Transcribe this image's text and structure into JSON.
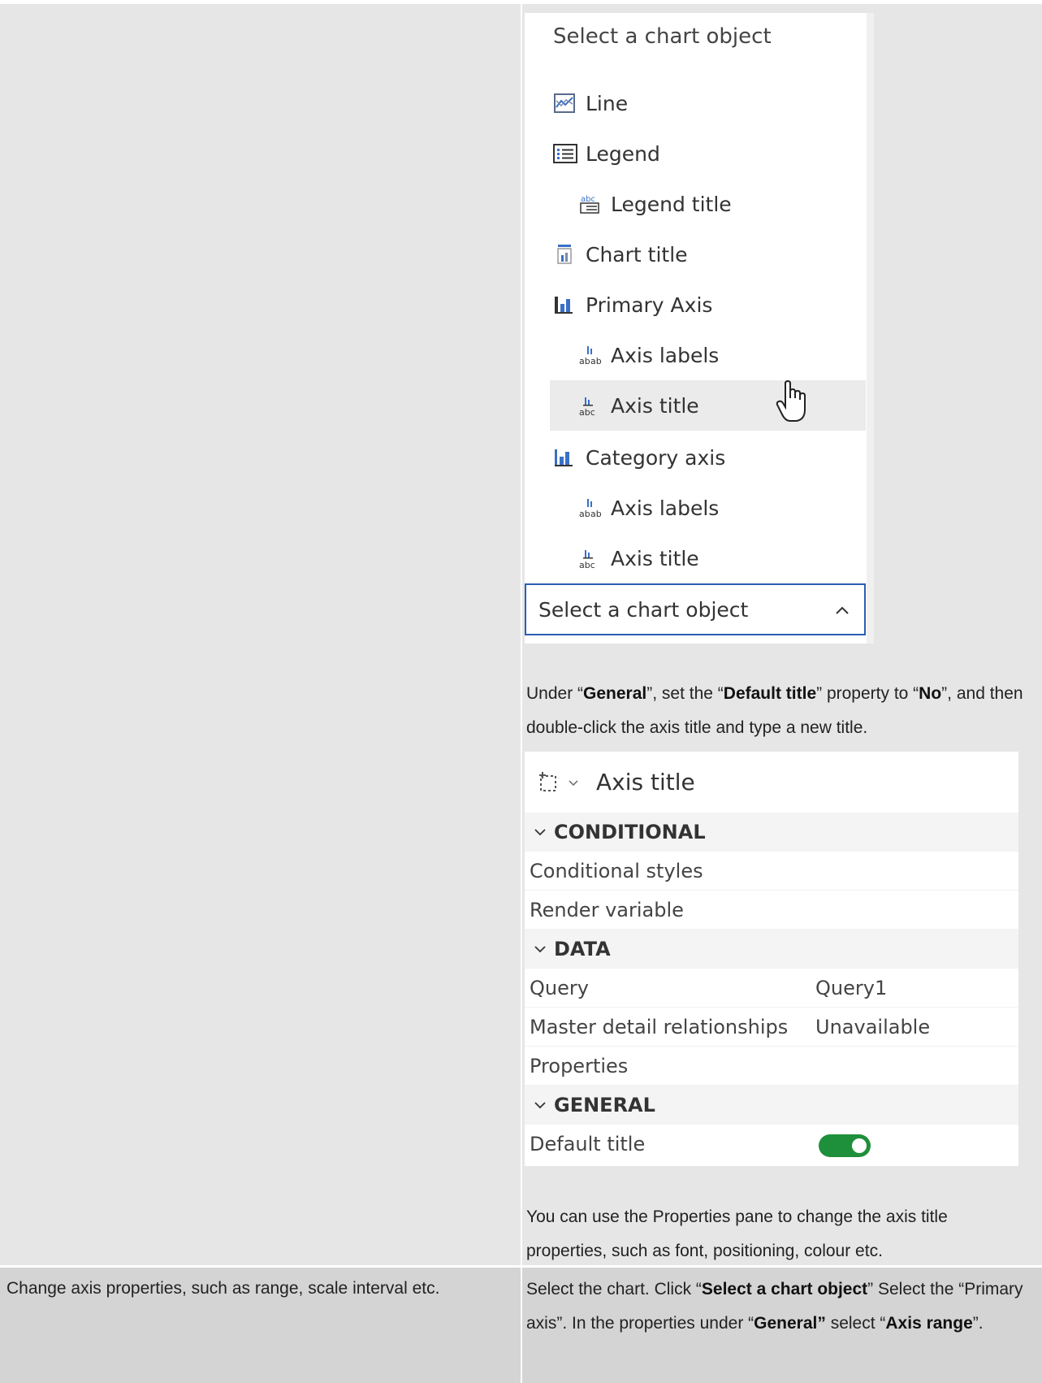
{
  "menu": {
    "header": "Select a chart object",
    "items": [
      {
        "label": "Line",
        "icon": "line-chart-icon",
        "indent": false
      },
      {
        "label": "Legend",
        "icon": "legend-icon",
        "indent": false
      },
      {
        "label": "Legend title",
        "icon": "legend-title-icon",
        "indent": true
      },
      {
        "label": "Chart title",
        "icon": "chart-title-icon",
        "indent": false
      },
      {
        "label": "Primary Axis",
        "icon": "primary-axis-icon",
        "indent": false
      },
      {
        "label": "Axis labels",
        "icon": "axis-labels-icon",
        "indent": true
      },
      {
        "label": "Axis title",
        "icon": "axis-title-icon",
        "indent": true,
        "highlighted": true
      },
      {
        "label": "Category axis",
        "icon": "category-axis-icon",
        "indent": false
      },
      {
        "label": "Axis labels",
        "icon": "axis-labels-icon",
        "indent": true
      },
      {
        "label": "Axis title",
        "icon": "axis-title-icon",
        "indent": true
      }
    ],
    "select_label": "Select a chart object"
  },
  "para1": {
    "t1": "Under “",
    "b1": "General",
    "t2": "”, set the “",
    "b2": "Default title",
    "t3": "” property to “",
    "b3": "No",
    "t4": "”, and then double-click the axis title and type a new title."
  },
  "properties": {
    "title": "Axis title",
    "sections": {
      "conditional": "CONDITIONAL",
      "data": "DATA",
      "general": "GENERAL"
    },
    "rows": {
      "conditional_styles": "Conditional styles",
      "render_variable": "Render variable",
      "query": "Query",
      "query_value": "Query1",
      "master_detail": "Master detail relationships",
      "master_detail_value": "Unavailable",
      "properties": "Properties",
      "default_title": "Default title"
    },
    "default_title_toggle": "on",
    "accent_color": "#1e8f3a"
  },
  "para2": "You can use the Properties pane to change the axis title properties, such as font, positioning, colour etc.",
  "row2": {
    "left": "Change axis properties, such as range, scale interval etc.",
    "t1": "Select the chart. Click “",
    "b1": "Select a chart object",
    "t2": "” Select the “Primary axis”. In the properties under “",
    "b2": "General”",
    "t3": " select “",
    "b3": "Axis range",
    "t4": "”."
  }
}
